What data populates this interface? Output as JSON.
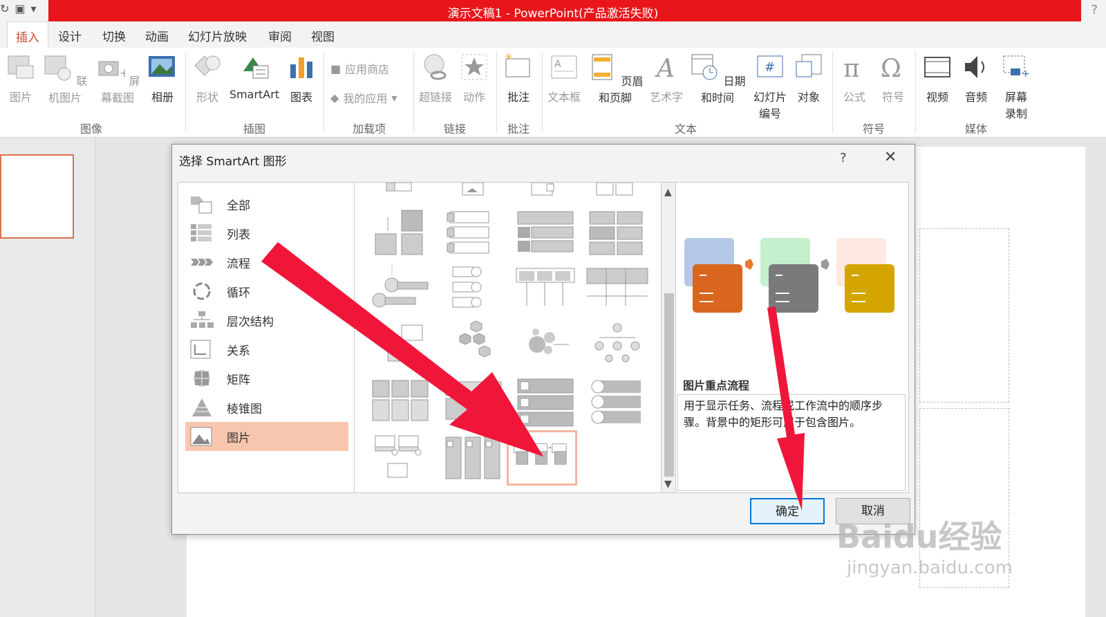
{
  "titlebar": {
    "title": "演示文稿1 - PowerPoint(产品激活失败)",
    "help": "?"
  },
  "tabs": [
    {
      "label": "插入",
      "active": true
    },
    {
      "label": "设计"
    },
    {
      "label": "切换"
    },
    {
      "label": "动画"
    },
    {
      "label": "幻灯片放映"
    },
    {
      "label": "审阅"
    },
    {
      "label": "视图"
    }
  ],
  "ribbon": {
    "images": {
      "label": "图像",
      "pictures": "图片",
      "online_pictures": "联机图片",
      "screenshot": "屏幕截图",
      "album": "相册"
    },
    "illustrations": {
      "label": "插图",
      "shapes": "形状",
      "smartart": "SmartArt",
      "chart": "图表"
    },
    "addins": {
      "label": "加载项",
      "store": "应用商店",
      "my_apps": "我的应用"
    },
    "links": {
      "label": "链接",
      "hyperlink": "超链接",
      "action": "动作"
    },
    "comments": {
      "label": "批注",
      "comment": "批注"
    },
    "text": {
      "label": "文本",
      "textbox": "文本框",
      "header_footer": "页眉和页脚",
      "wordart": "艺术字",
      "datetime": "日期和时间",
      "slide_number_1": "幻灯片",
      "slide_number_2": "编号",
      "object": "对象"
    },
    "symbols": {
      "label": "符号",
      "equation": "公式",
      "symbol": "符号"
    },
    "media": {
      "label": "媒体",
      "video": "视频",
      "audio": "音频",
      "screen_rec_1": "屏幕",
      "screen_rec_2": "录制"
    }
  },
  "dialog": {
    "title": "选择 SmartArt 图形",
    "help": "?",
    "close": "✕",
    "categories": [
      {
        "label": "全部"
      },
      {
        "label": "列表"
      },
      {
        "label": "流程"
      },
      {
        "label": "循环"
      },
      {
        "label": "层次结构"
      },
      {
        "label": "关系"
      },
      {
        "label": "矩阵"
      },
      {
        "label": "棱锥图"
      },
      {
        "label": "图片",
        "selected": true
      }
    ],
    "preview": {
      "name": "图片重点流程",
      "description": "用于显示任务、流程或工作流中的顺序步骤。背景中的矩形可用于包含图片。"
    },
    "ok": "确定",
    "cancel": "取消"
  },
  "watermark": {
    "line1": "Baidu经验",
    "line2": "jingyan.baidu.com"
  },
  "colors": {
    "title_red": "#e8161b",
    "accent_orange": "#d24726",
    "selection": "#f8c6ae",
    "arrow": "#f0163a"
  }
}
